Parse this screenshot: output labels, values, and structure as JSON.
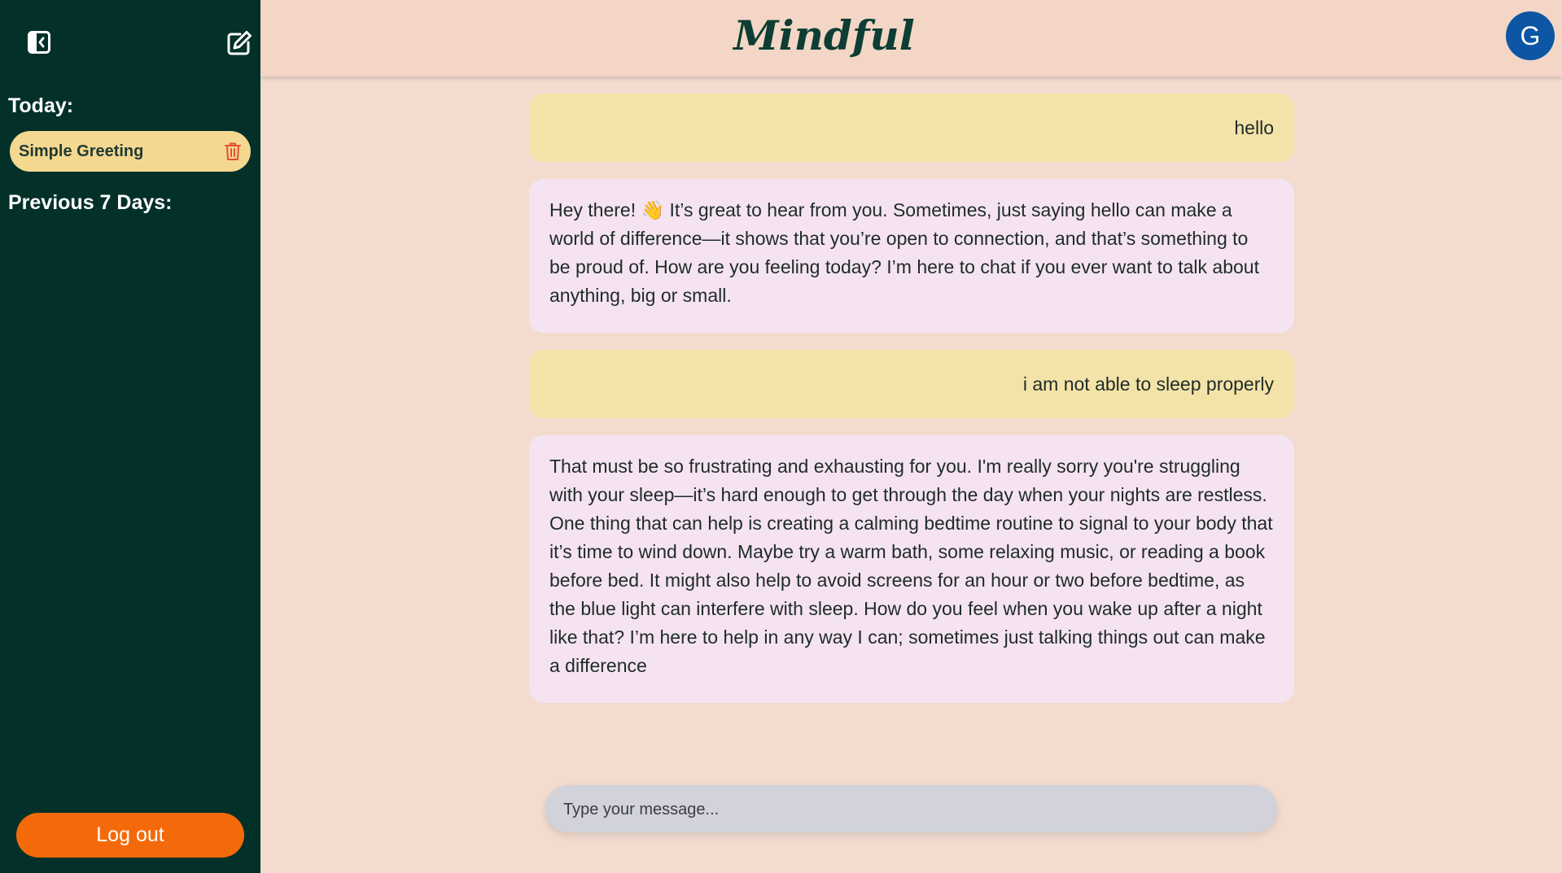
{
  "sidebar": {
    "toggle_icon": "sidebar-collapse-icon",
    "new_chat_icon": "edit-icon",
    "today_label": "Today:",
    "today_items": [
      {
        "label": "Simple Greeting",
        "icon": "trash-icon"
      }
    ],
    "previous_label": "Previous 7 Days:",
    "logout_label": "Log out"
  },
  "header": {
    "brand": "Mindful",
    "avatar_initial": "G"
  },
  "messages": [
    {
      "role": "user",
      "text": "hello"
    },
    {
      "role": "assistant",
      "text": "Hey there! 👋 It’s great to hear from you. Sometimes, just saying hello can make a world of difference—it shows that you’re open to connection, and that’s something to be proud of. How are you feeling today? I’m here to chat if you ever want to talk about anything, big or small."
    },
    {
      "role": "user",
      "text": "i am not able to sleep properly"
    },
    {
      "role": "assistant",
      "text": "That must be so frustrating and exhausting for you. I'm really sorry you're struggling with your sleep—it’s hard enough to get through the day when your nights are restless. One thing that can help is creating a calming bedtime routine to signal to your body that it’s time to wind down. Maybe try a warm bath, some relaxing music, or reading a book before bed. It might also help to avoid screens for an hour or two before bedtime, as the blue light can interfere with sleep. How do you feel when you wake up after a night like that? I’m here to help in any way I can; sometimes just talking things out can make a difference"
    }
  ],
  "composer": {
    "placeholder": "Type your message...",
    "value": ""
  },
  "colors": {
    "sidebar_bg": "#04302a",
    "main_bg": "#f3dccf",
    "user_bubble": "#f4e3a8",
    "assistant_bubble": "#f5e3f2",
    "chat_item_bg": "#f4d890",
    "logout_bg": "#f46a0a",
    "avatar_bg": "#0c56a3",
    "trash": "#e4502e"
  }
}
